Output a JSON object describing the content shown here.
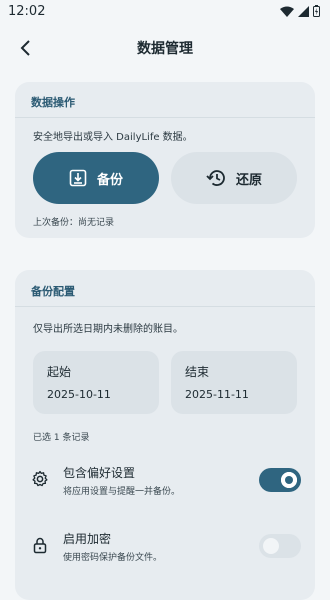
{
  "status": {
    "time": "12:02"
  },
  "header": {
    "title": "数据管理"
  },
  "operations": {
    "title": "数据操作",
    "description": "安全地导出或导入 DailyLife 数据。",
    "backup_label": "备份",
    "restore_label": "还原",
    "last_backup": "上次备份：尚无记录"
  },
  "config": {
    "title": "备份配置",
    "description": "仅导出所选日期内未删除的账目。",
    "start_label": "起始",
    "start_date": "2025-10-11",
    "end_label": "结束",
    "end_date": "2025-11-11",
    "selected_count": "已选 1 条记录",
    "prefs": {
      "title": "包含偏好设置",
      "subtitle": "将应用设置与提醒一并备份。",
      "enabled": true
    },
    "encrypt": {
      "title": "启用加密",
      "subtitle": "使用密码保护备份文件。",
      "enabled": false
    }
  },
  "colors": {
    "accent": "#2f6580",
    "card": "#e7ecf0",
    "background": "#f3f6f8"
  }
}
